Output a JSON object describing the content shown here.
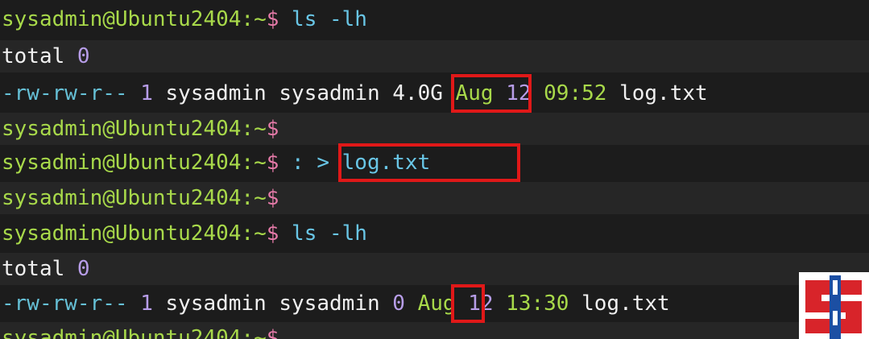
{
  "terminal": {
    "lines": [
      {
        "prompt": "sysadmin@Ubuntu2404:~",
        "dollar": "$",
        "cmd": " ls -lh"
      },
      {
        "text": "total ",
        "zero": "0"
      },
      {
        "perm": "-rw-rw-r--",
        "links": " 1 ",
        "owner": "sysadmin sysadmin ",
        "size": "4.0G",
        "month": " Aug ",
        "day": "12",
        "time": " 09:52",
        "file": " log.txt"
      },
      {
        "prompt": "sysadmin@Ubuntu2404:~",
        "dollar": "$"
      },
      {
        "prompt": "sysadmin@Ubuntu2404:~",
        "dollar": "$",
        "cmd": " : > log.txt"
      },
      {
        "prompt": "sysadmin@Ubuntu2404:~",
        "dollar": "$"
      },
      {
        "prompt": "sysadmin@Ubuntu2404:~",
        "dollar": "$",
        "cmd": " ls -lh"
      },
      {
        "text": "total ",
        "zero": "0"
      },
      {
        "perm": "-rw-rw-r--",
        "links": " 1 ",
        "owner": "sysadmin sysadmin ",
        "size": "0",
        "month": " Aug ",
        "day": "12",
        "time": " 13:30",
        "file": " log.txt"
      },
      {
        "prompt": "sysadmin@Ubuntu2404:~",
        "dollar": "$"
      }
    ]
  },
  "highlight_color": "#e01818",
  "logo": {
    "icon": "sb-logo-icon",
    "colors": [
      "#d8242a",
      "#1c4fa3",
      "#ffffff"
    ]
  }
}
